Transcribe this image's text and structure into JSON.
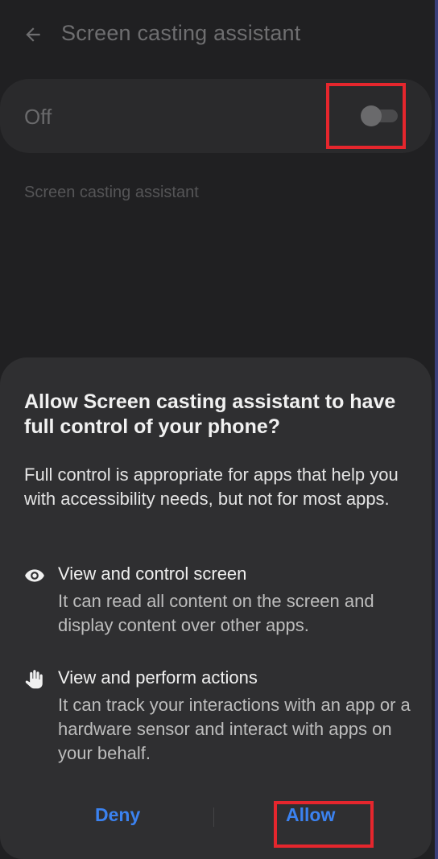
{
  "appbar": {
    "title": "Screen casting assistant",
    "back_icon": "arrow-left-icon"
  },
  "master_switch": {
    "label": "Off",
    "state": "off"
  },
  "section": {
    "caption": "Screen casting assistant"
  },
  "dialog": {
    "title": "Allow Screen casting assistant to have full control of your phone?",
    "body": "Full control is appropriate for apps that help you with accessibility needs, but not for most apps.",
    "permissions": [
      {
        "icon": "eye-icon",
        "title": "View and control screen",
        "description": "It can read all content on the screen and display content over other apps."
      },
      {
        "icon": "hand-icon",
        "title": "View and perform actions",
        "description": "It can track your interactions with an app or a hardware sensor and interact with apps on your behalf."
      }
    ],
    "deny_label": "Deny",
    "allow_label": "Allow"
  },
  "colors": {
    "accent": "#3b82f0",
    "highlight": "#e5262d",
    "sheet_background": "#2f2f31",
    "screen_background": "#202022"
  }
}
